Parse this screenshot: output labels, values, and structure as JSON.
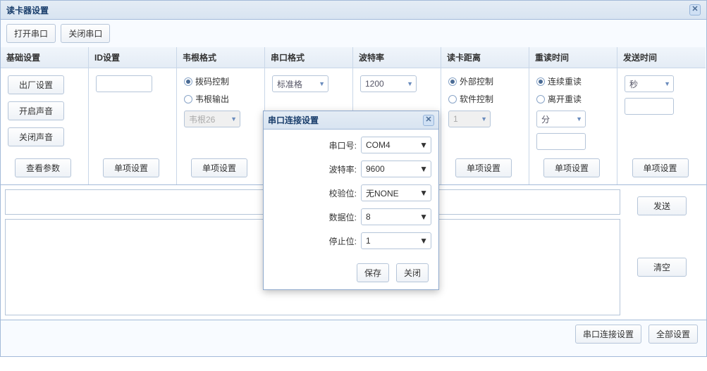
{
  "title": "读卡器设置",
  "toolbar": {
    "open": "打开串口",
    "close": "关闭串口"
  },
  "cols": {
    "basic": {
      "header": "基础设置",
      "factory": "出厂设置",
      "soundOn": "开启声音",
      "soundOff": "关闭声音",
      "view": "查看参数"
    },
    "id": {
      "header": "ID设置",
      "single": "单项设置"
    },
    "wiegand": {
      "header": "韦根格式",
      "r1": "拨码控制",
      "r2": "韦根输出",
      "sel": "韦根26",
      "single": "单项设置"
    },
    "serialfmt": {
      "header": "串口格式",
      "sel": "标准格"
    },
    "baud": {
      "header": "波特率",
      "sel": "1200"
    },
    "distance": {
      "header": "读卡距离",
      "r1": "外部控制",
      "r2": "软件控制",
      "sel": "1",
      "single": "单项设置"
    },
    "reread": {
      "header": "重读时间",
      "r1": "连续重读",
      "r2": "离开重读",
      "sel": "分",
      "single": "单项设置"
    },
    "send": {
      "header": "发送时间",
      "sel": "秒",
      "single": "单项设置"
    }
  },
  "right": {
    "send": "发送",
    "clear": "清空"
  },
  "bottom": {
    "serial": "串口连接设置",
    "all": "全部设置"
  },
  "modal": {
    "title": "串口连接设置",
    "rows": {
      "port": {
        "label": "串口号:",
        "value": "COM4"
      },
      "baud": {
        "label": "波特率:",
        "value": "9600"
      },
      "parity": {
        "label": "校验位:",
        "value": "无NONE"
      },
      "data": {
        "label": "数据位:",
        "value": "8"
      },
      "stop": {
        "label": "停止位:",
        "value": "1"
      }
    },
    "save": "保存",
    "close": "关闭"
  }
}
